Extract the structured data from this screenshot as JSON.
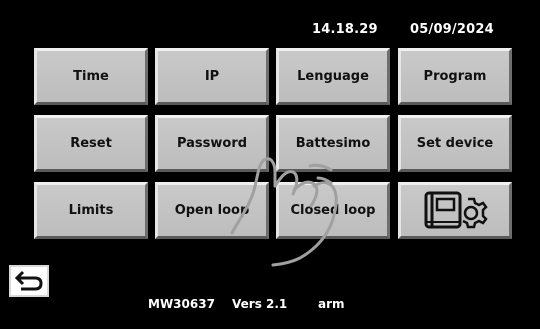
{
  "status_bar": {
    "time": "14.18.29",
    "date": "05/09/2024"
  },
  "menu": {
    "row1": [
      "Time",
      "IP",
      "Lenguage",
      "Program"
    ],
    "row2": [
      "Reset",
      "Password",
      "Battesimo",
      "Set device"
    ],
    "row3": [
      "Limits",
      "Open loop",
      "Closed loop"
    ]
  },
  "icons": {
    "settings_button": "book-gear-icon",
    "back_button": "back-arrow-icon",
    "touch_indicator": "hand-pointer-icon"
  },
  "footer": {
    "model": "MW30637",
    "version": "Vers 2.1",
    "arch": "arm"
  },
  "colors": {
    "background": "#000000",
    "button_face": "#c4c4c4",
    "button_text": "#111111",
    "text": "#ffffff"
  }
}
